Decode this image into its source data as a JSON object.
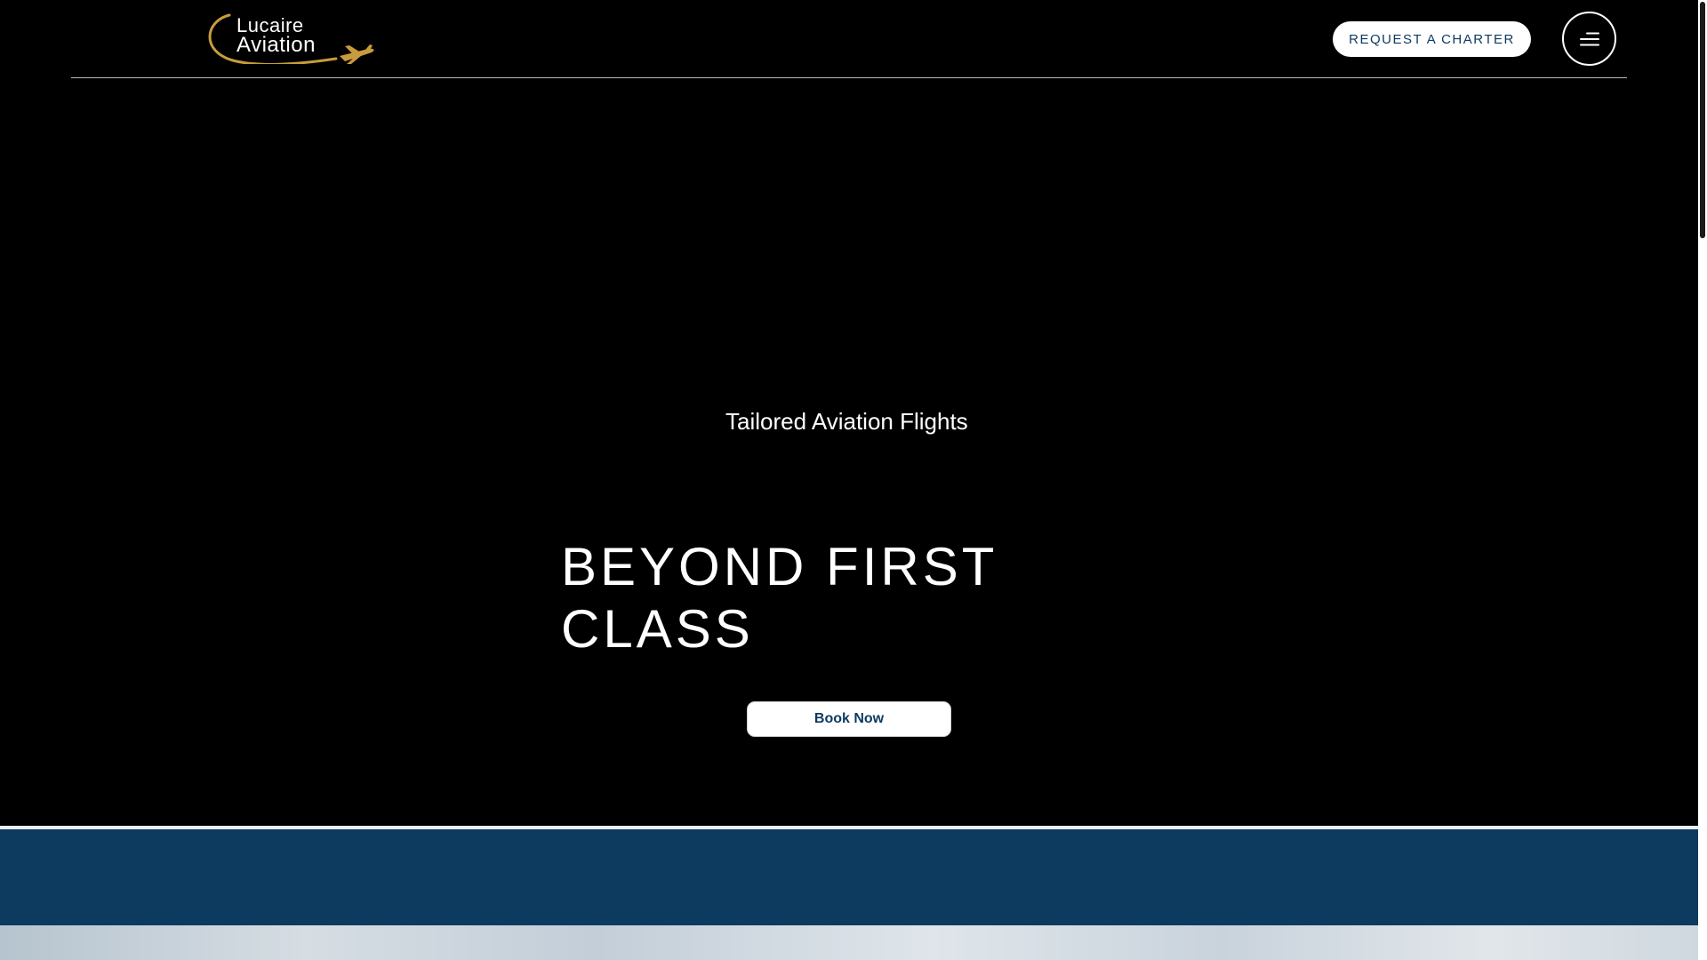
{
  "header": {
    "logo": {
      "line1": "Lucaire",
      "line2": "Aviation",
      "gold_color": "#c89b3c",
      "icon": "plane-icon"
    },
    "charter_button": "REQUEST A CHARTER",
    "menu_icon": "hamburger-menu-icon"
  },
  "hero": {
    "tagline": "Tailored Aviation Flights",
    "headline": "BEYOND FIRST CLASS",
    "book_button": "Book Now"
  },
  "colors": {
    "background": "#000000",
    "navy": "#0d3a5f",
    "white": "#ffffff",
    "gold": "#c89b3c"
  }
}
